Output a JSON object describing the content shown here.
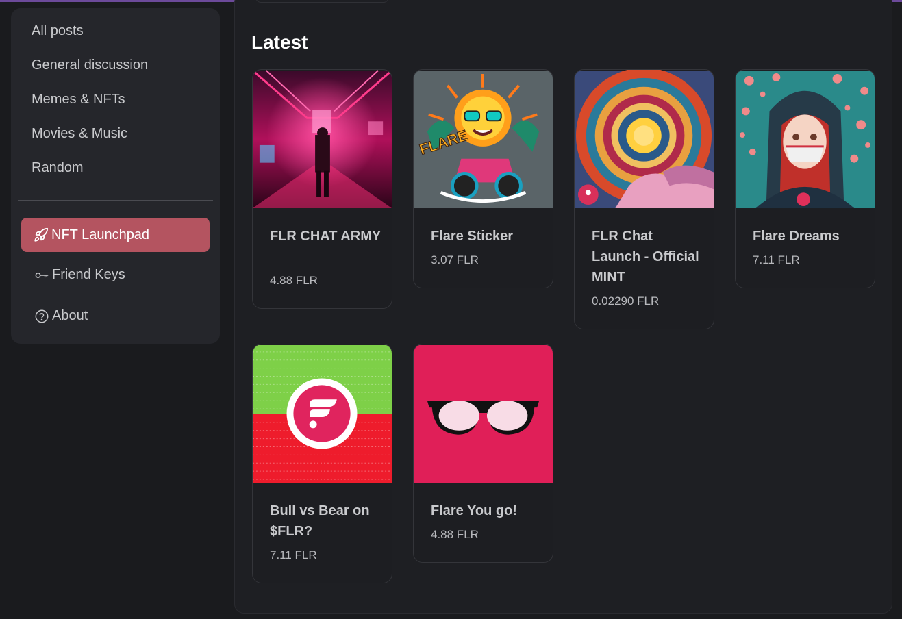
{
  "sidebar": {
    "items": [
      {
        "label": "All posts"
      },
      {
        "label": "General discussion"
      },
      {
        "label": "Memes & NFTs"
      },
      {
        "label": "Movies & Music"
      },
      {
        "label": "Random"
      }
    ],
    "launchpad": {
      "label": "NFT Launchpad",
      "icon": "rocket-icon"
    },
    "friend_keys": {
      "label": "Friend Keys",
      "icon": "key-icon"
    },
    "about": {
      "label": "About",
      "icon": "question-circle-icon"
    }
  },
  "main": {
    "section_title": "Latest",
    "cards": [
      {
        "title": "FLR CHAT ARMY",
        "price": "4.88 FLR"
      },
      {
        "title": "Flare Sticker",
        "price": "3.07 FLR"
      },
      {
        "title": "FLR Chat Launch - Official MINT",
        "price": "0.02290 FLR"
      },
      {
        "title": "Flare Dreams",
        "price": "7.11 FLR"
      },
      {
        "title": "Bull vs Bear on $FLR?",
        "price": "7.11 FLR"
      },
      {
        "title": "Flare You go!",
        "price": "4.88 FLR"
      }
    ]
  },
  "colors": {
    "accent": "#b45460",
    "background": "#1a1b1e",
    "panel": "#25262b"
  }
}
